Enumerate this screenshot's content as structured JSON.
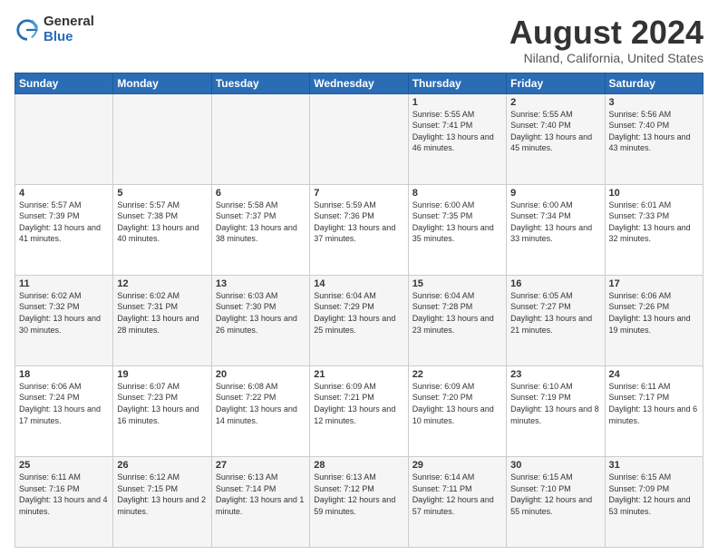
{
  "header": {
    "logo_general": "General",
    "logo_blue": "Blue",
    "month_title": "August 2024",
    "location": "Niland, California, United States"
  },
  "days_of_week": [
    "Sunday",
    "Monday",
    "Tuesday",
    "Wednesday",
    "Thursday",
    "Friday",
    "Saturday"
  ],
  "weeks": [
    [
      {
        "day": "",
        "sunrise": "",
        "sunset": "",
        "daylight": ""
      },
      {
        "day": "",
        "sunrise": "",
        "sunset": "",
        "daylight": ""
      },
      {
        "day": "",
        "sunrise": "",
        "sunset": "",
        "daylight": ""
      },
      {
        "day": "",
        "sunrise": "",
        "sunset": "",
        "daylight": ""
      },
      {
        "day": "1",
        "sunrise": "Sunrise: 5:55 AM",
        "sunset": "Sunset: 7:41 PM",
        "daylight": "Daylight: 13 hours and 46 minutes."
      },
      {
        "day": "2",
        "sunrise": "Sunrise: 5:55 AM",
        "sunset": "Sunset: 7:40 PM",
        "daylight": "Daylight: 13 hours and 45 minutes."
      },
      {
        "day": "3",
        "sunrise": "Sunrise: 5:56 AM",
        "sunset": "Sunset: 7:40 PM",
        "daylight": "Daylight: 13 hours and 43 minutes."
      }
    ],
    [
      {
        "day": "4",
        "sunrise": "Sunrise: 5:57 AM",
        "sunset": "Sunset: 7:39 PM",
        "daylight": "Daylight: 13 hours and 41 minutes."
      },
      {
        "day": "5",
        "sunrise": "Sunrise: 5:57 AM",
        "sunset": "Sunset: 7:38 PM",
        "daylight": "Daylight: 13 hours and 40 minutes."
      },
      {
        "day": "6",
        "sunrise": "Sunrise: 5:58 AM",
        "sunset": "Sunset: 7:37 PM",
        "daylight": "Daylight: 13 hours and 38 minutes."
      },
      {
        "day": "7",
        "sunrise": "Sunrise: 5:59 AM",
        "sunset": "Sunset: 7:36 PM",
        "daylight": "Daylight: 13 hours and 37 minutes."
      },
      {
        "day": "8",
        "sunrise": "Sunrise: 6:00 AM",
        "sunset": "Sunset: 7:35 PM",
        "daylight": "Daylight: 13 hours and 35 minutes."
      },
      {
        "day": "9",
        "sunrise": "Sunrise: 6:00 AM",
        "sunset": "Sunset: 7:34 PM",
        "daylight": "Daylight: 13 hours and 33 minutes."
      },
      {
        "day": "10",
        "sunrise": "Sunrise: 6:01 AM",
        "sunset": "Sunset: 7:33 PM",
        "daylight": "Daylight: 13 hours and 32 minutes."
      }
    ],
    [
      {
        "day": "11",
        "sunrise": "Sunrise: 6:02 AM",
        "sunset": "Sunset: 7:32 PM",
        "daylight": "Daylight: 13 hours and 30 minutes."
      },
      {
        "day": "12",
        "sunrise": "Sunrise: 6:02 AM",
        "sunset": "Sunset: 7:31 PM",
        "daylight": "Daylight: 13 hours and 28 minutes."
      },
      {
        "day": "13",
        "sunrise": "Sunrise: 6:03 AM",
        "sunset": "Sunset: 7:30 PM",
        "daylight": "Daylight: 13 hours and 26 minutes."
      },
      {
        "day": "14",
        "sunrise": "Sunrise: 6:04 AM",
        "sunset": "Sunset: 7:29 PM",
        "daylight": "Daylight: 13 hours and 25 minutes."
      },
      {
        "day": "15",
        "sunrise": "Sunrise: 6:04 AM",
        "sunset": "Sunset: 7:28 PM",
        "daylight": "Daylight: 13 hours and 23 minutes."
      },
      {
        "day": "16",
        "sunrise": "Sunrise: 6:05 AM",
        "sunset": "Sunset: 7:27 PM",
        "daylight": "Daylight: 13 hours and 21 minutes."
      },
      {
        "day": "17",
        "sunrise": "Sunrise: 6:06 AM",
        "sunset": "Sunset: 7:26 PM",
        "daylight": "Daylight: 13 hours and 19 minutes."
      }
    ],
    [
      {
        "day": "18",
        "sunrise": "Sunrise: 6:06 AM",
        "sunset": "Sunset: 7:24 PM",
        "daylight": "Daylight: 13 hours and 17 minutes."
      },
      {
        "day": "19",
        "sunrise": "Sunrise: 6:07 AM",
        "sunset": "Sunset: 7:23 PM",
        "daylight": "Daylight: 13 hours and 16 minutes."
      },
      {
        "day": "20",
        "sunrise": "Sunrise: 6:08 AM",
        "sunset": "Sunset: 7:22 PM",
        "daylight": "Daylight: 13 hours and 14 minutes."
      },
      {
        "day": "21",
        "sunrise": "Sunrise: 6:09 AM",
        "sunset": "Sunset: 7:21 PM",
        "daylight": "Daylight: 13 hours and 12 minutes."
      },
      {
        "day": "22",
        "sunrise": "Sunrise: 6:09 AM",
        "sunset": "Sunset: 7:20 PM",
        "daylight": "Daylight: 13 hours and 10 minutes."
      },
      {
        "day": "23",
        "sunrise": "Sunrise: 6:10 AM",
        "sunset": "Sunset: 7:19 PM",
        "daylight": "Daylight: 13 hours and 8 minutes."
      },
      {
        "day": "24",
        "sunrise": "Sunrise: 6:11 AM",
        "sunset": "Sunset: 7:17 PM",
        "daylight": "Daylight: 13 hours and 6 minutes."
      }
    ],
    [
      {
        "day": "25",
        "sunrise": "Sunrise: 6:11 AM",
        "sunset": "Sunset: 7:16 PM",
        "daylight": "Daylight: 13 hours and 4 minutes."
      },
      {
        "day": "26",
        "sunrise": "Sunrise: 6:12 AM",
        "sunset": "Sunset: 7:15 PM",
        "daylight": "Daylight: 13 hours and 2 minutes."
      },
      {
        "day": "27",
        "sunrise": "Sunrise: 6:13 AM",
        "sunset": "Sunset: 7:14 PM",
        "daylight": "Daylight: 13 hours and 1 minute."
      },
      {
        "day": "28",
        "sunrise": "Sunrise: 6:13 AM",
        "sunset": "Sunset: 7:12 PM",
        "daylight": "Daylight: 12 hours and 59 minutes."
      },
      {
        "day": "29",
        "sunrise": "Sunrise: 6:14 AM",
        "sunset": "Sunset: 7:11 PM",
        "daylight": "Daylight: 12 hours and 57 minutes."
      },
      {
        "day": "30",
        "sunrise": "Sunrise: 6:15 AM",
        "sunset": "Sunset: 7:10 PM",
        "daylight": "Daylight: 12 hours and 55 minutes."
      },
      {
        "day": "31",
        "sunrise": "Sunrise: 6:15 AM",
        "sunset": "Sunset: 7:09 PM",
        "daylight": "Daylight: 12 hours and 53 minutes."
      }
    ]
  ]
}
